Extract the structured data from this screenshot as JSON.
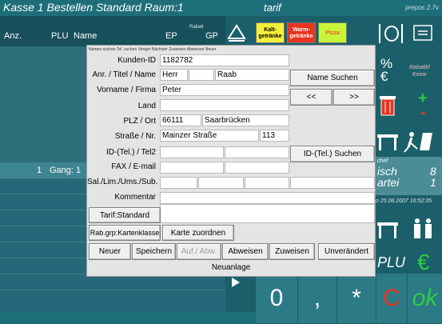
{
  "window": {
    "title": "Kasse 1 Bestellen Standard Raum:1",
    "center_label": "tarif",
    "brand": "prepos 2.7v"
  },
  "order_table": {
    "headers": [
      "Anz.",
      "PLU",
      "Name",
      "EP",
      "GP"
    ],
    "rabatt_label": "Rabatt",
    "row": {
      "qty": "1",
      "label": "Gang: 1"
    }
  },
  "categories": [
    {
      "label": "Kalt-\ngetränke",
      "color": "#f5ef3a"
    },
    {
      "label": "Warm-\ngetränke",
      "color": "#e8351f"
    },
    {
      "label": "Pizza",
      "color": "#c8f53a"
    }
  ],
  "right_pad": {
    "percent_euro": "%\n€",
    "rabattkl": "Rabattkl\nKeine",
    "plus": "+",
    "minus": "-",
    "chef": "chef",
    "table_label": "isch",
    "table_num": "8",
    "partei_label": "artei",
    "partei_num": "1",
    "datetime": "o 25.06.2007 16:52:35",
    "plu": "PLU",
    "euro": "€",
    "zero": "0",
    "comma": ",",
    "star": "*",
    "c": "C",
    "ok": "ok"
  },
  "dialog": {
    "menu": "Namen suchen   Tel. suchen   Voriger   Nächster   Zuweisen   Abweisen   Neuer",
    "labels": {
      "kunden_id": "Kunden-ID",
      "anrede": "Anr. / Titel / Name",
      "vorname": "Vorname / Firma",
      "land": "Land",
      "plz": "PLZ / Ort",
      "strasse": "Straße / Nr.",
      "tel": "ID-(Tel.) / Tel2",
      "fax": "FAX / E-mail",
      "sal": "Sal./Lim./Ums./Sub.",
      "kommentar": "Kommentar"
    },
    "values": {
      "kunden_id": "1182782",
      "anrede": "Herr",
      "titel": "",
      "name": "Raab",
      "vorname": "Peter",
      "land": "",
      "plz": "66111",
      "ort": "Saarbrücken",
      "strasse": "Mainzer Straße",
      "nr": "113"
    },
    "buttons": {
      "name_suchen": "Name Suchen",
      "prev": "<<",
      "next": ">>",
      "tel_suchen": "ID-(Tel.) Suchen",
      "tarif": "Tarif:Standard",
      "rabgrp": "Rab.grp:Kartenklasse",
      "karte": "Karte zuordnen",
      "neuer": "Neuer",
      "speichern": "Speichern",
      "aufabw": "Auf./ Abw.",
      "abweisen": "Abweisen",
      "zuweisen": "Zuweisen",
      "unveraendert": "Unverändert"
    },
    "footer": "Neuanlage"
  },
  "colors": {
    "background": "#1b5f6b",
    "accent_green": "#2ecc40",
    "accent_red": "#e8351f"
  }
}
